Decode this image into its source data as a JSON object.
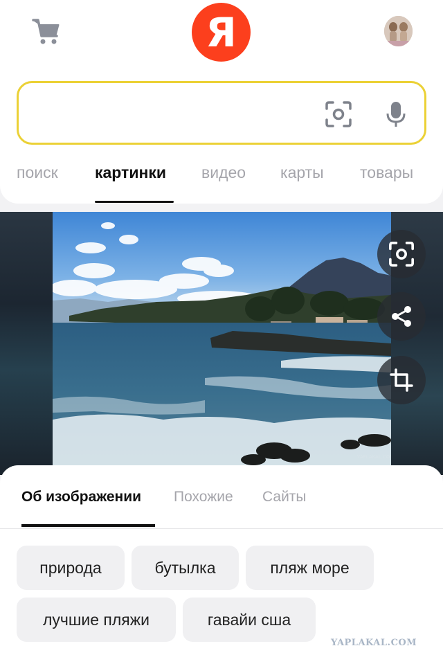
{
  "header": {
    "logo_text": "Я",
    "cart_icon": "cart-icon",
    "avatar_icon": "avatar"
  },
  "search": {
    "value": "",
    "placeholder": "",
    "camera_icon": "camera-lens-icon",
    "mic_icon": "microphone-icon"
  },
  "tabs": [
    {
      "label": "поиск",
      "active": false
    },
    {
      "label": "картинки",
      "active": true
    },
    {
      "label": "видео",
      "active": false
    },
    {
      "label": "карты",
      "active": false
    },
    {
      "label": "товары",
      "active": false
    }
  ],
  "viewer": {
    "photo_watermark": "YAPLAKAL.COM",
    "actions": [
      {
        "icon": "lens-search-icon"
      },
      {
        "icon": "share-icon"
      },
      {
        "icon": "crop-icon"
      }
    ]
  },
  "sheet": {
    "tabs": [
      {
        "label": "Об изображении",
        "active": true
      },
      {
        "label": "Похожие",
        "active": false
      },
      {
        "label": "Сайты",
        "active": false
      }
    ],
    "chips": [
      "природа",
      "бутылка",
      "пляж море",
      "лучшие пляжи",
      "гавайи сша"
    ]
  },
  "watermark": "YAPLAKAL.COM",
  "colors": {
    "logo_red": "#fc3f1d",
    "search_border": "#ebd136",
    "inactive_text": "#a5a5ab"
  }
}
